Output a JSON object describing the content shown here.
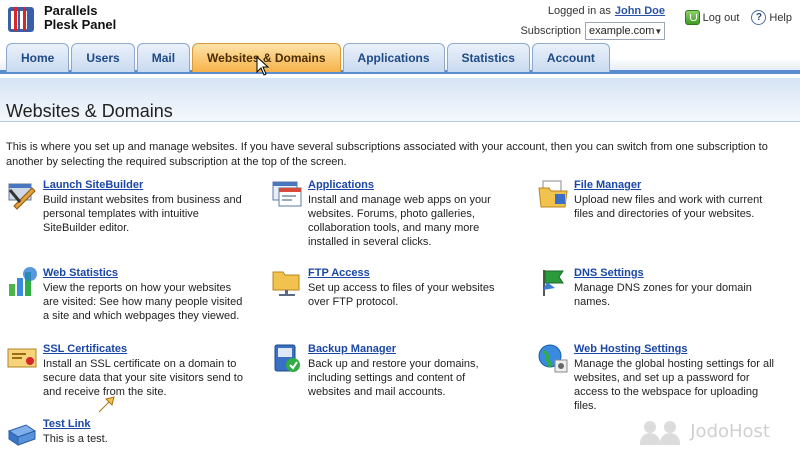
{
  "header": {
    "brand_line1": "Parallels",
    "brand_line2": "Plesk Panel",
    "logged_in_label": "Logged in as",
    "user_name": "John Doe",
    "subscription_label": "Subscription",
    "subscription_value": "example.com",
    "logout_label": "Log out",
    "help_label": "Help"
  },
  "tabs": [
    {
      "label": "Home"
    },
    {
      "label": "Users"
    },
    {
      "label": "Mail"
    },
    {
      "label": "Websites & Domains",
      "active": true
    },
    {
      "label": "Applications"
    },
    {
      "label": "Statistics"
    },
    {
      "label": "Account"
    }
  ],
  "page": {
    "title": "Websites & Domains",
    "intro": "This is where you set up and manage websites. If you have several subscriptions associated with your account, then you can switch from one subscription to another by selecting the required subscription at the top of the screen."
  },
  "tools": [
    {
      "name": "Launch SiteBuilder",
      "desc": "Build instant websites from business and personal templates with intuitive SiteBuilder editor.",
      "icon": "sitebuilder-icon"
    },
    {
      "name": "Applications",
      "desc": "Install and manage web apps on your websites. Forums, photo galleries, collaboration tools, and many more installed in several clicks.",
      "icon": "applications-icon"
    },
    {
      "name": "File Manager",
      "desc": "Upload new files and work with current files and directories of your websites.",
      "icon": "file-manager-icon"
    },
    {
      "name": "Web Statistics",
      "desc": "View the reports on how your websites are visited: See how many people visited a site and which webpages they viewed.",
      "icon": "web-statistics-icon"
    },
    {
      "name": "FTP Access",
      "desc": "Set up access to files of your websites over FTP protocol.",
      "icon": "ftp-folder-icon"
    },
    {
      "name": "DNS Settings",
      "desc": "Manage DNS zones for your domain names.",
      "icon": "dns-flag-icon"
    },
    {
      "name": "SSL Certificates",
      "desc": "Install an SSL certificate on a domain to secure data that your site visitors send to and receive from the site.",
      "icon": "ssl-certificate-icon"
    },
    {
      "name": "Backup Manager",
      "desc": "Back up and restore your domains, including settings and content of websites and mail accounts.",
      "icon": "backup-icon"
    },
    {
      "name": "Web Hosting Settings",
      "desc": "Manage the global hosting settings for all websites, and set up a password for access to the webspace for uploading files.",
      "icon": "web-hosting-globe-icon"
    },
    {
      "name": "Test Link",
      "desc": "This is a test.",
      "icon": "test-link-icon"
    }
  ],
  "watermark": "JodoHost",
  "colors": {
    "tab_active": "#f6b24b",
    "tab_bg": "#c9daf0",
    "link": "#1a47a6",
    "accent_bar": "#5a8dcf"
  }
}
